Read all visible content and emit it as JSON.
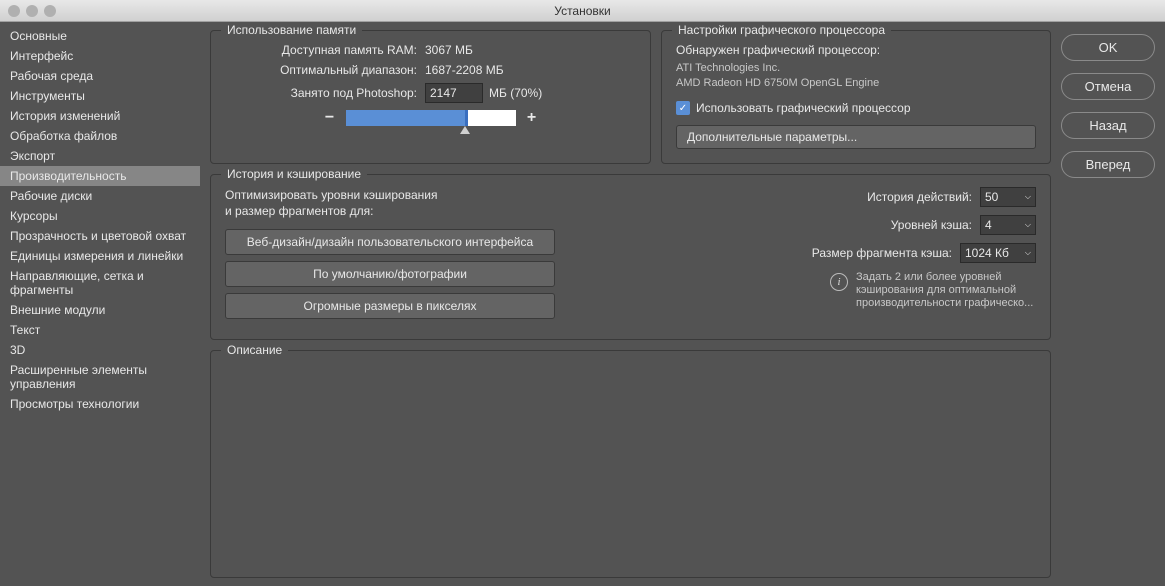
{
  "window": {
    "title": "Установки"
  },
  "sidebar": {
    "items": [
      {
        "label": "Основные"
      },
      {
        "label": "Интерфейс"
      },
      {
        "label": "Рабочая среда"
      },
      {
        "label": "Инструменты"
      },
      {
        "label": "История изменений"
      },
      {
        "label": "Обработка файлов"
      },
      {
        "label": "Экспорт"
      },
      {
        "label": "Производительность"
      },
      {
        "label": "Рабочие диски"
      },
      {
        "label": "Курсоры"
      },
      {
        "label": "Прозрачность и цветовой охват"
      },
      {
        "label": "Единицы измерения и линейки"
      },
      {
        "label": "Направляющие, сетка и фрагменты"
      },
      {
        "label": "Внешние модули"
      },
      {
        "label": "Текст"
      },
      {
        "label": "3D"
      },
      {
        "label": "Расширенные элементы управления"
      },
      {
        "label": "Просмотры технологии"
      }
    ],
    "active_index": 7
  },
  "buttons": {
    "ok": "OK",
    "cancel": "Отмена",
    "back": "Назад",
    "forward": "Вперед"
  },
  "memory": {
    "legend": "Использование памяти",
    "available_label": "Доступная память RAM:",
    "available_value": "3067 МБ",
    "ideal_label": "Оптимальный диапазон:",
    "ideal_value": "1687-2208 МБ",
    "used_label": "Занято под Photoshop:",
    "used_value": "2147",
    "used_suffix": "МБ (70%)",
    "slider_percent": 70,
    "ideal_start": 55,
    "ideal_end": 72
  },
  "gpu": {
    "legend": "Настройки графического процессора",
    "detected_label": "Обнаружен графический процессор:",
    "vendor": "ATI Technologies Inc.",
    "device": "AMD Radeon HD 6750M OpenGL Engine",
    "use_gpu_checked": true,
    "use_gpu_label": "Использовать графический процессор",
    "advanced_btn": "Дополнительные параметры..."
  },
  "history": {
    "legend": "История и кэширование",
    "hint1": "Оптимизировать уровни кэширования",
    "hint2": "и размер фрагментов для:",
    "preset1": "Веб-дизайн/дизайн пользовательского интерфейса",
    "preset2": "По умолчанию/фотографии",
    "preset3": "Огромные размеры в пикселях",
    "states_label": "История действий:",
    "states_value": "50",
    "levels_label": "Уровней кэша:",
    "levels_value": "4",
    "tile_label": "Размер фрагмента кэша:",
    "tile_value": "1024 Кб",
    "info_text": "Задать 2 или более уровней кэширования для оптимальной производительности графическо..."
  },
  "description": {
    "legend": "Описание"
  }
}
